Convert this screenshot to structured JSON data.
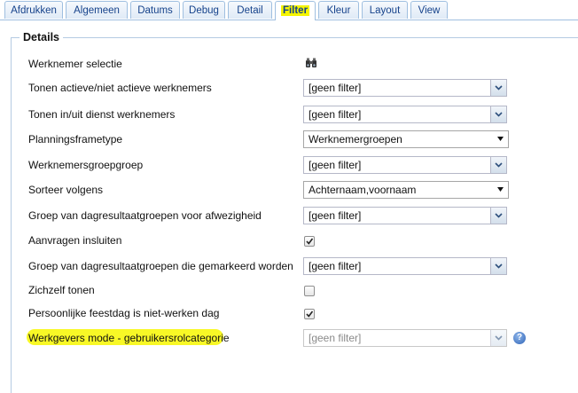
{
  "tabs": [
    {
      "label": "Afdrukken"
    },
    {
      "label": "Algemeen"
    },
    {
      "label": "Datums"
    },
    {
      "label": "Debug"
    },
    {
      "label": "Detail"
    },
    {
      "label": "Filter"
    },
    {
      "label": "Kleur"
    },
    {
      "label": "Layout"
    },
    {
      "label": "View"
    }
  ],
  "active_tab": "Filter",
  "section": {
    "title": "Details"
  },
  "rows": [
    {
      "label": "Werknemer selectie",
      "control": "icon",
      "icon": "binoculars-icon"
    },
    {
      "label": "Tonen actieve/niet actieve werknemers",
      "control": "combo",
      "value": "[geen filter]"
    },
    {
      "label": "Tonen in/uit dienst werknemers",
      "control": "combo",
      "value": "[geen filter]"
    },
    {
      "label": "Planningsframetype",
      "control": "select",
      "value": "Werknemergroepen"
    },
    {
      "label": "Werknemersgroepgroep",
      "control": "combo",
      "value": "[geen filter]"
    },
    {
      "label": "Sorteer volgens",
      "control": "select",
      "value": "Achternaam,voornaam"
    },
    {
      "label": "Groep van dagresultaatgroepen voor afwezigheid",
      "control": "combo",
      "value": "[geen filter]"
    },
    {
      "label": "Aanvragen insluiten",
      "control": "checkbox",
      "checked": true
    },
    {
      "label": "Groep van dagresultaatgroepen die gemarkeerd worden",
      "control": "combo",
      "value": "[geen filter]"
    },
    {
      "label": "Zichzelf tonen",
      "control": "checkbox",
      "checked": false
    },
    {
      "label": "Persoonlijke feestdag is niet-werken dag",
      "control": "checkbox",
      "checked": true
    },
    {
      "label": "Werkgevers mode - gebruikersrolcategorie",
      "control": "combo",
      "value": "[geen filter]",
      "disabled": true,
      "help_icon": "help-icon"
    }
  ],
  "colors": {
    "highlight": "#f7f700",
    "tab_text": "#15428b",
    "border": "#9fbfe0"
  }
}
